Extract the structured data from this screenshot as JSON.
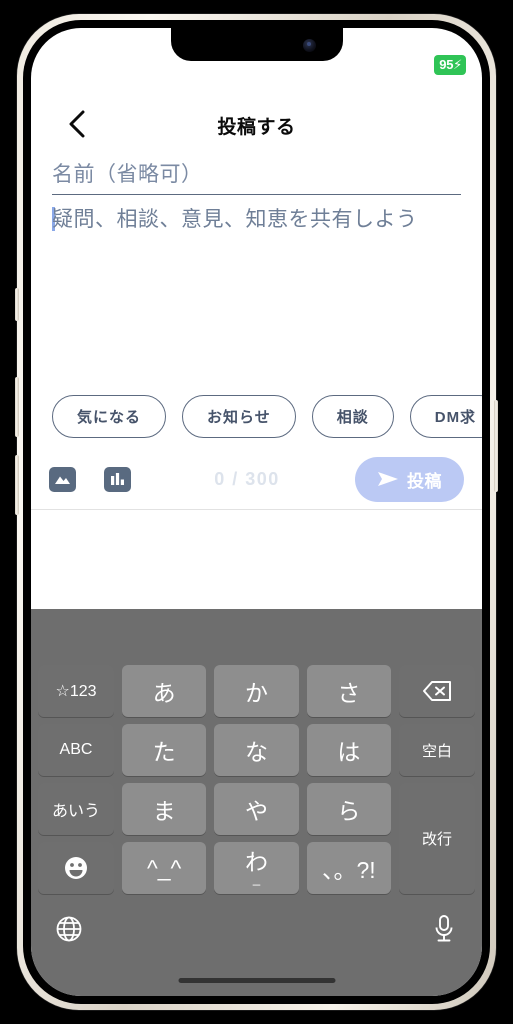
{
  "status": {
    "battery_level": "95",
    "battery_bolt": "⚡",
    "battery_color": "#2fc456"
  },
  "header": {
    "back_icon": "chevron-left-icon",
    "title": "投稿する"
  },
  "compose": {
    "name_placeholder": "名前（省略可）",
    "name_value": "",
    "body_placeholder": "疑問、相談、意見、知恵を共有しよう",
    "body_value": ""
  },
  "chips": [
    {
      "label": "気になる"
    },
    {
      "label": "お知らせ"
    },
    {
      "label": "相談"
    },
    {
      "label": "DM求"
    }
  ],
  "toolbar": {
    "image_icon": "image-icon",
    "poll_icon": "poll-bar-chart-icon",
    "counter": "0 / 300",
    "post_label": "投稿",
    "post_icon": "send-icon",
    "post_color": "#bbc9f4"
  },
  "keyboard": {
    "rows": [
      [
        {
          "label": "☆123",
          "type": "fn"
        },
        {
          "label": "あ",
          "type": "char"
        },
        {
          "label": "か",
          "type": "char"
        },
        {
          "label": "さ",
          "type": "char"
        },
        {
          "label": "",
          "type": "delete",
          "icon": "delete-backspace-icon"
        }
      ],
      [
        {
          "label": "ABC",
          "type": "fn"
        },
        {
          "label": "た",
          "type": "char"
        },
        {
          "label": "な",
          "type": "char"
        },
        {
          "label": "は",
          "type": "char"
        },
        {
          "label": "空白",
          "type": "fn"
        }
      ],
      [
        {
          "label": "あいう",
          "type": "fn"
        },
        {
          "label": "ま",
          "type": "char"
        },
        {
          "label": "や",
          "type": "char"
        },
        {
          "label": "ら",
          "type": "char"
        },
        {
          "label": "改行",
          "type": "fn-tall"
        }
      ],
      [
        {
          "label": "",
          "type": "emoji",
          "icon": "emoji-smiley-icon"
        },
        {
          "label": "^_^",
          "type": "char"
        },
        {
          "label": "わ",
          "sub": "_",
          "type": "char"
        },
        {
          "label": "、。?!",
          "type": "char"
        }
      ]
    ],
    "globe_icon": "globe-icon",
    "mic_icon": "microphone-icon"
  }
}
